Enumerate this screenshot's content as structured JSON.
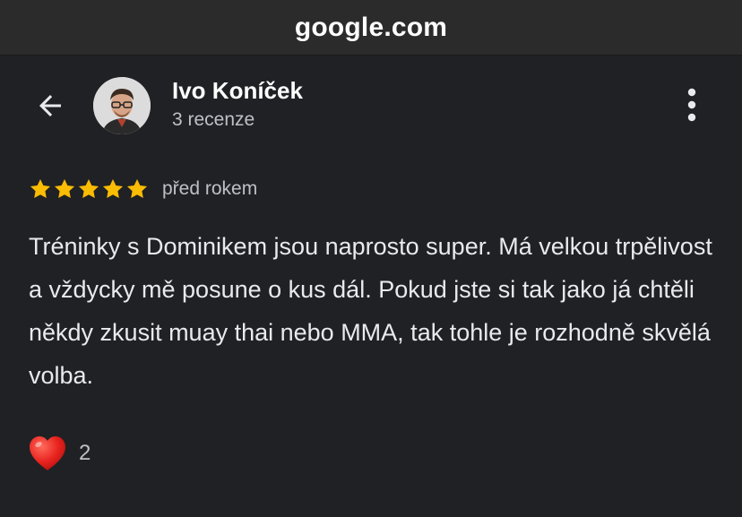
{
  "browser": {
    "url": "google.com"
  },
  "reviewer": {
    "name": "Ivo Koníček",
    "review_count": "3 recenze"
  },
  "review": {
    "rating": 5,
    "rating_max": 5,
    "star_color": "#fbbc04",
    "date": "před rokem",
    "text": "Tréninky s Dominikem jsou naprosto super. Má velkou trpělivost a vždycky mě posune o kus dál. Pokud jste si tak jako já chtěli někdy zkusit muay thai nebo MMA, tak tohle je rozhodně skvělá volba."
  },
  "reactions": {
    "icon": "red-heart-icon",
    "count": "2"
  },
  "icons": {
    "back": "arrow-left-icon",
    "more": "more-vert-icon"
  }
}
